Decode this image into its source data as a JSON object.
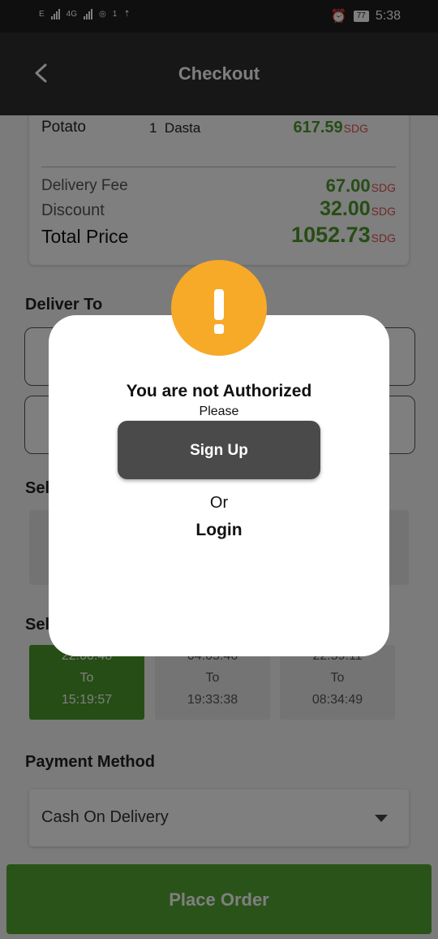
{
  "status_bar": {
    "network_1": "E",
    "network_2": "4G",
    "hotspot_count": "1",
    "battery": "77",
    "time": "5:38"
  },
  "app_bar": {
    "title": "Checkout"
  },
  "order_item": {
    "name": "Potato",
    "quantity": "1",
    "unit": "Dasta",
    "price": "617.59",
    "currency": "SDG"
  },
  "summary": {
    "delivery_fee_label": "Delivery Fee",
    "delivery_fee": "67.00",
    "discount_label": "Discount",
    "discount": "32.00",
    "total_label": "Total Price",
    "total": "1052.73",
    "currency": "SDG"
  },
  "sections": {
    "deliver_to": "Deliver To",
    "select_1": "Sel",
    "select_2": "Sel",
    "payment_method": "Payment Method"
  },
  "time_slots": [
    {
      "start": "22:00:48",
      "to": "To",
      "end": "15:19:57",
      "active": true
    },
    {
      "start": "04:05:46",
      "to": "To",
      "end": "19:33:38",
      "active": false
    },
    {
      "start": "22:59:11",
      "to": "To",
      "end": "08:34:49",
      "active": false
    }
  ],
  "payment": {
    "selected": "Cash On Delivery"
  },
  "place_order_label": "Place Order",
  "dialog": {
    "title": "You are not Authorized",
    "please": "Please",
    "sign_up_label": "Sign Up",
    "or": "Or",
    "login_label": "Login"
  },
  "colors": {
    "accent_green": "#4c9a2a",
    "currency_red": "#e05050",
    "alert_orange": "#f7a928",
    "app_bar": "#2e2e2e"
  }
}
